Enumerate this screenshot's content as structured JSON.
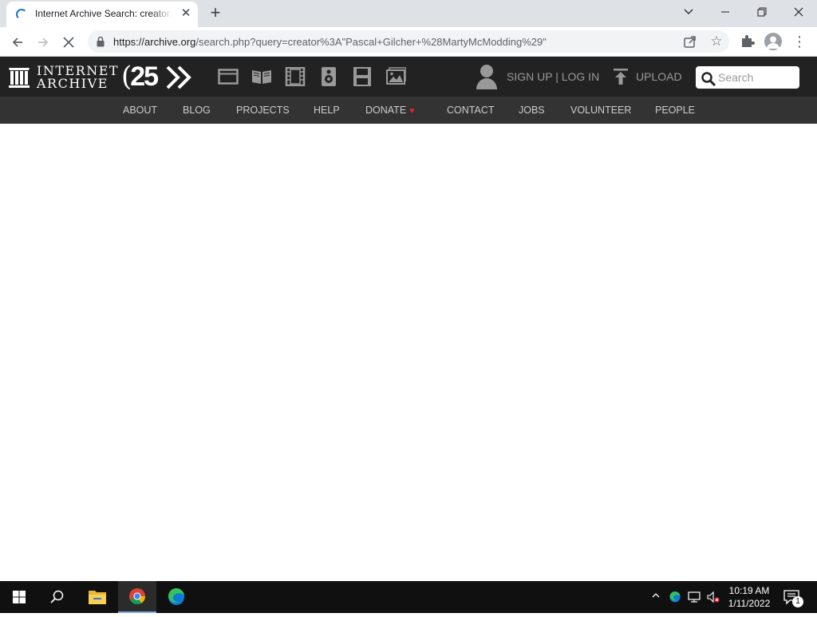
{
  "browser": {
    "tab": {
      "title": "Internet Archive Search: creator:\"Pascal+Gilcher+(MartyMcModding)\""
    },
    "address": {
      "url_host": "https://archive.org",
      "url_rest": "/search.php?query=creator%3A\"Pascal+Gilcher+%28MartyMcModding%29\""
    },
    "icons": {
      "back": "arrow-left-icon",
      "forward": "arrow-right-icon",
      "stop": "close-icon",
      "bookmark": "star-icon",
      "menu": "more-vert-icon"
    }
  },
  "ia_header": {
    "logo_line1": "INTERNET",
    "logo_line2": "ARCHIVE",
    "anniversary": "25",
    "signup_login": "SIGN UP | LOG IN",
    "upload": "UPLOAD",
    "search_placeholder": "Search",
    "media_icons": [
      "web-icon",
      "texts-icon",
      "video-icon",
      "audio-icon",
      "software-icon",
      "images-icon"
    ]
  },
  "ia_subnav": {
    "items": [
      "ABOUT",
      "BLOG",
      "PROJECTS",
      "HELP",
      "DONATE",
      "CONTACT",
      "JOBS",
      "VOLUNTEER",
      "PEOPLE"
    ],
    "donate_heart": "♥"
  },
  "taskbar": {
    "time": "10:19 AM",
    "date": "1/11/2022",
    "notification_count": "1"
  },
  "colors": {
    "ia_topnav_bg": "#222222",
    "ia_subnav_bg": "#333333",
    "donate_heart": "#e0242b",
    "taskbar_bg": "#101010",
    "chrome_tabstrip": "#dee1e6"
  }
}
